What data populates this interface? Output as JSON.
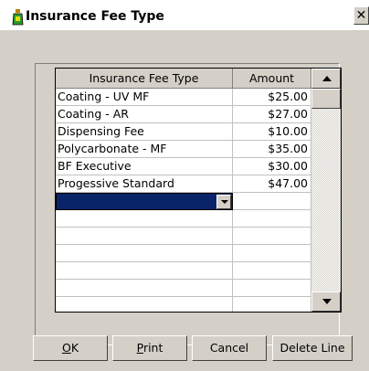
{
  "window": {
    "title": "Insurance Fee Type",
    "close_glyph": "✕",
    "icon": "lab-flask-icon"
  },
  "grid": {
    "columns": [
      "Insurance Fee Type",
      "Amount"
    ],
    "rows": [
      {
        "type": "Coating - UV MF",
        "amount": "$25.00"
      },
      {
        "type": "Coating - AR",
        "amount": "$27.00"
      },
      {
        "type": "Dispensing Fee",
        "amount": "$10.00"
      },
      {
        "type": "Polycarbonate - MF",
        "amount": "$35.00"
      },
      {
        "type": "BF Executive",
        "amount": "$30.00"
      },
      {
        "type": "Progessive Standard",
        "amount": "$47.00"
      }
    ],
    "selection_color": "#0a246a"
  },
  "buttons": {
    "ok": {
      "mnemonic": "O",
      "rest": "K"
    },
    "print": {
      "mnemonic": "P",
      "rest": "rint"
    },
    "cancel": {
      "label": "Cancel"
    },
    "delete": {
      "label": "Delete Line"
    }
  }
}
